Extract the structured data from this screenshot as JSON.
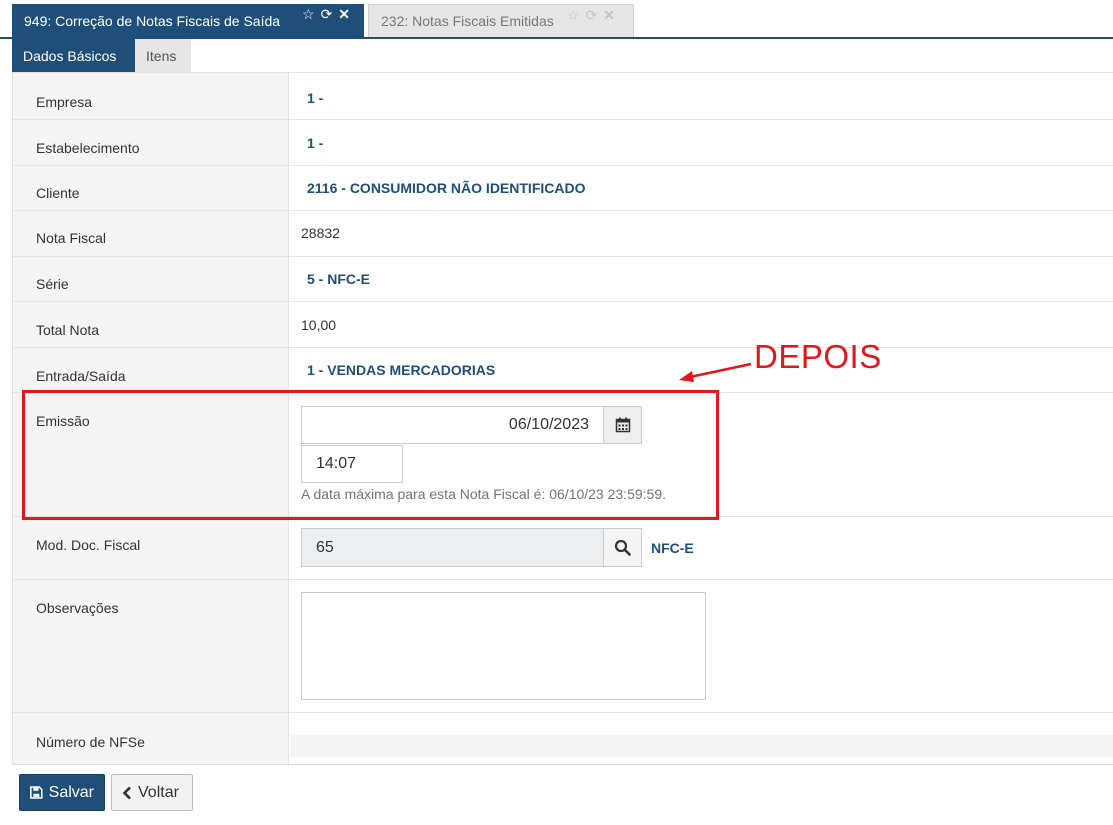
{
  "tabs": [
    {
      "label": "949: Correção de Notas Fiscais de Saída",
      "active": true
    },
    {
      "label": "232: Notas Fiscais Emitidas",
      "active": false
    }
  ],
  "tab_icons": [
    "star-icon",
    "refresh-icon",
    "close-icon"
  ],
  "subtabs": [
    {
      "label": "Dados Básicos",
      "active": true
    },
    {
      "label": "Itens",
      "active": false
    }
  ],
  "fields": {
    "empresa": {
      "label": "Empresa",
      "value": "1 -"
    },
    "estabelecimento": {
      "label": "Estabelecimento",
      "value": "1 -"
    },
    "cliente": {
      "label": "Cliente",
      "value": "2116 - CONSUMIDOR NÃO IDENTIFICADO"
    },
    "nota_fiscal": {
      "label": "Nota Fiscal",
      "value": "28832"
    },
    "serie": {
      "label": "Série",
      "value": "5 - NFC-E"
    },
    "total_nota": {
      "label": "Total Nota",
      "value": "10,00"
    },
    "entrada_saida": {
      "label": "Entrada/Saída",
      "value": "1 - VENDAS MERCADORIAS"
    },
    "emissao": {
      "label": "Emissão",
      "date": "06/10/2023",
      "time": "14:07",
      "help": "A data máxima para esta Nota Fiscal é: 06/10/23 23:59:59."
    },
    "mod_doc_fiscal": {
      "label": "Mod. Doc. Fiscal",
      "value": "65",
      "description": "NFC-E"
    },
    "observacoes": {
      "label": "Observações",
      "value": ""
    },
    "numero_nfse": {
      "label": "Número de NFSe"
    }
  },
  "annotation": {
    "text": "DEPOIS",
    "color": "#e8141a"
  },
  "buttons": {
    "save": "Salvar",
    "back": "Voltar"
  },
  "colors": {
    "primary": "#1f4e79",
    "label_bg": "#f5f5f5",
    "annotation": "#e8141a"
  }
}
